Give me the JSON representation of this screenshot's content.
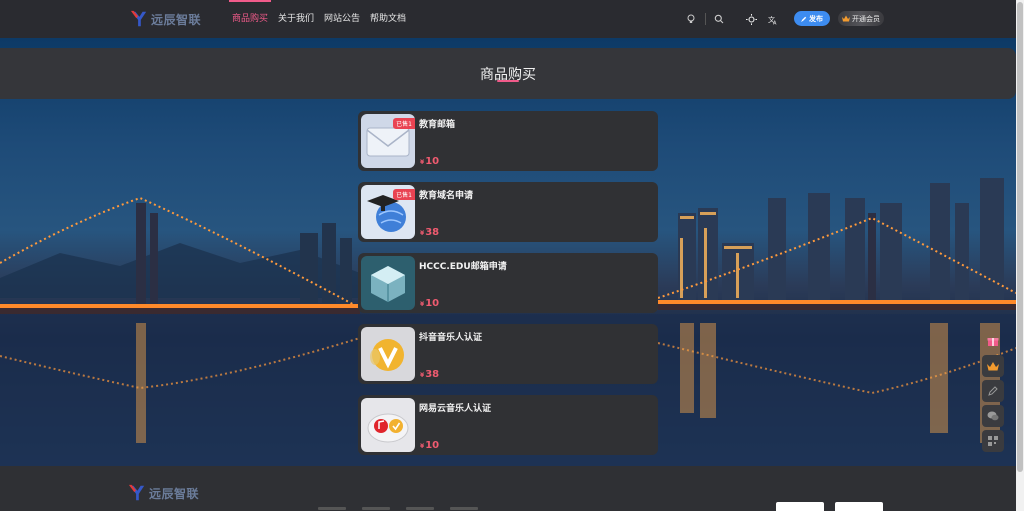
{
  "header": {
    "logo_text": "远辰智联",
    "nav": [
      {
        "label": "商品购买",
        "active": true
      },
      {
        "label": "关于我们",
        "active": false
      },
      {
        "label": "网站公告",
        "active": false
      },
      {
        "label": "帮助文档",
        "active": false
      }
    ],
    "publish_label": "发布",
    "vip_label": "开通会员"
  },
  "page": {
    "title": "商品购买"
  },
  "products": [
    {
      "name": "教育邮箱",
      "price": "10",
      "currency": "¥",
      "badge": "已售1",
      "icon": "envelope-icon"
    },
    {
      "name": "教育域名申请",
      "price": "38",
      "currency": "¥",
      "badge": "已售1",
      "icon": "graduation-globe-icon"
    },
    {
      "name": "HCCC.EDU邮箱申请",
      "price": "10",
      "currency": "¥",
      "badge": "",
      "icon": "glass-cube-icon"
    },
    {
      "name": "抖音音乐人认证",
      "price": "38",
      "currency": "¥",
      "badge": "",
      "icon": "verified-v-icon"
    },
    {
      "name": "网易云音乐人认证",
      "price": "10",
      "currency": "¥",
      "badge": "",
      "icon": "music-cloud-icon"
    }
  ],
  "footer": {
    "logo_text": "远辰智联"
  },
  "colors": {
    "accent": "#f05b8a",
    "price": "#f05b70",
    "publish": "#3d8cf0",
    "card": "#303134"
  }
}
